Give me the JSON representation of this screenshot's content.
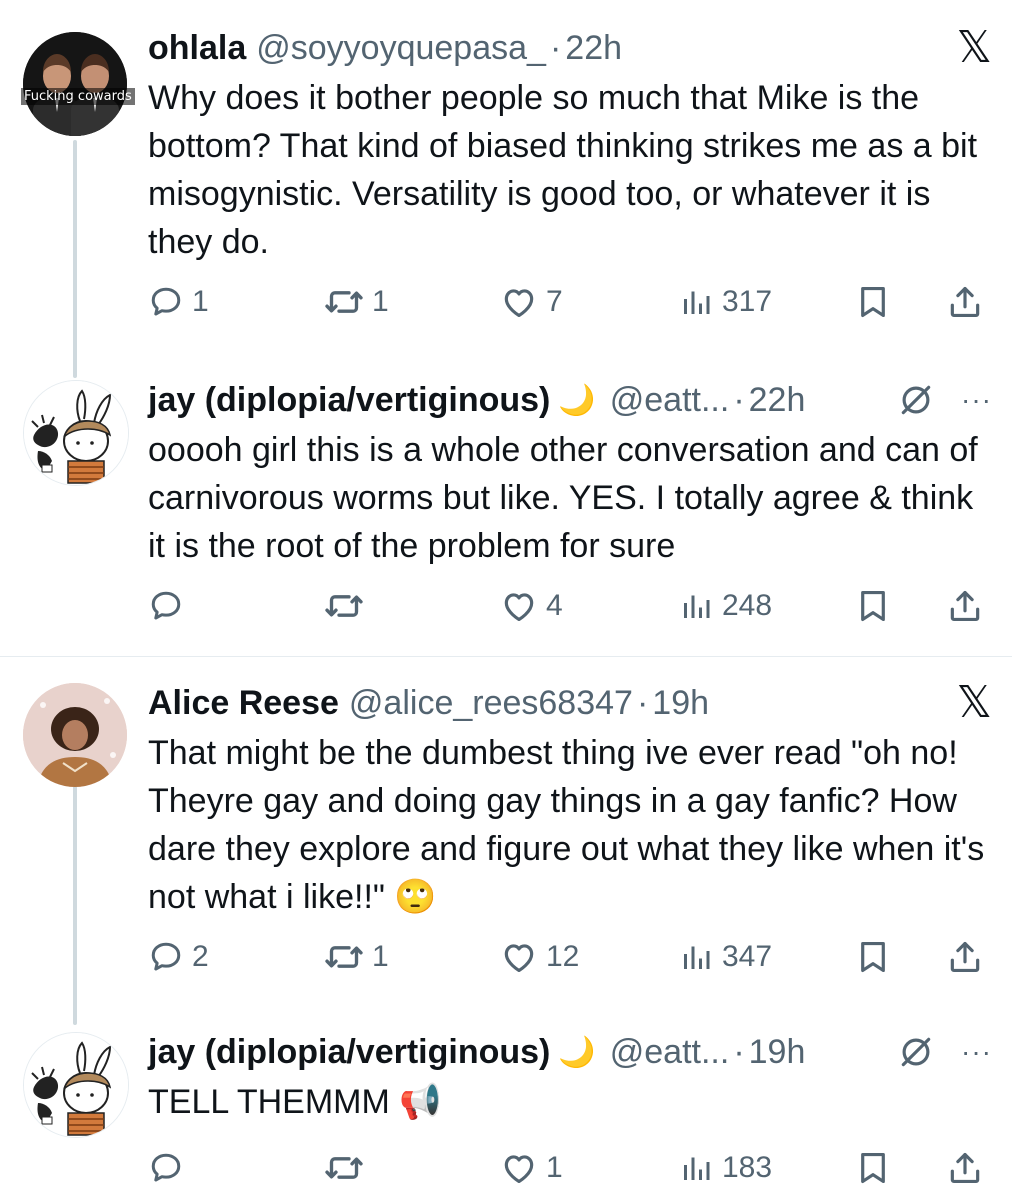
{
  "tweets": [
    {
      "name": "ohlala",
      "handle": "@soyyoyquepasa_",
      "dot": "·",
      "time": "22h",
      "avatar_caption": "Fucking cowards",
      "text": "Why does it bother people so much that Mike is the bottom? That kind of biased thinking strikes me as a bit misogynistic. Versatility is good too, or whatever it is they do.",
      "replies": "1",
      "retweets": "1",
      "likes": "7",
      "views": "317"
    },
    {
      "name": "jay (diplopia/vertiginous)",
      "moon": "🌙",
      "handle": "@eatt...",
      "dot": "·",
      "time": "22h",
      "more": "···",
      "text": "ooooh girl this is a whole other conversation and can of carnivorous worms but like. YES. I totally agree & think it is the root of the problem for sure",
      "replies": "",
      "retweets": "",
      "likes": "4",
      "views": "248"
    },
    {
      "name": "Alice Reese",
      "handle": "@alice_rees68347",
      "dot": "·",
      "time": "19h",
      "text": "That might be the dumbest thing ive ever read \"oh no! Theyre gay and doing gay things in a gay fanfic? How dare they explore and figure out what they like when it's not what i like!!\" 🙄",
      "replies": "2",
      "retweets": "1",
      "likes": "12",
      "views": "347"
    },
    {
      "name": "jay (diplopia/vertiginous)",
      "moon": "🌙",
      "handle": "@eatt...",
      "dot": "·",
      "time": "19h",
      "more": "···",
      "text": "TELL THEMMM 📢",
      "replies": "",
      "retweets": "",
      "likes": "1",
      "views": "183"
    }
  ],
  "icons": {
    "x_logo": "x-logo-icon",
    "reply": "reply-icon",
    "retweet": "retweet-icon",
    "like": "heart-icon",
    "views": "views-icon",
    "bookmark": "bookmark-icon",
    "share": "share-icon",
    "slash": "slash-circle-icon",
    "more": "more-icon"
  },
  "colors": {
    "text": "#0f1419",
    "muted": "#536471",
    "thread_line": "#cfd9de",
    "divider": "#e6ecf0"
  }
}
